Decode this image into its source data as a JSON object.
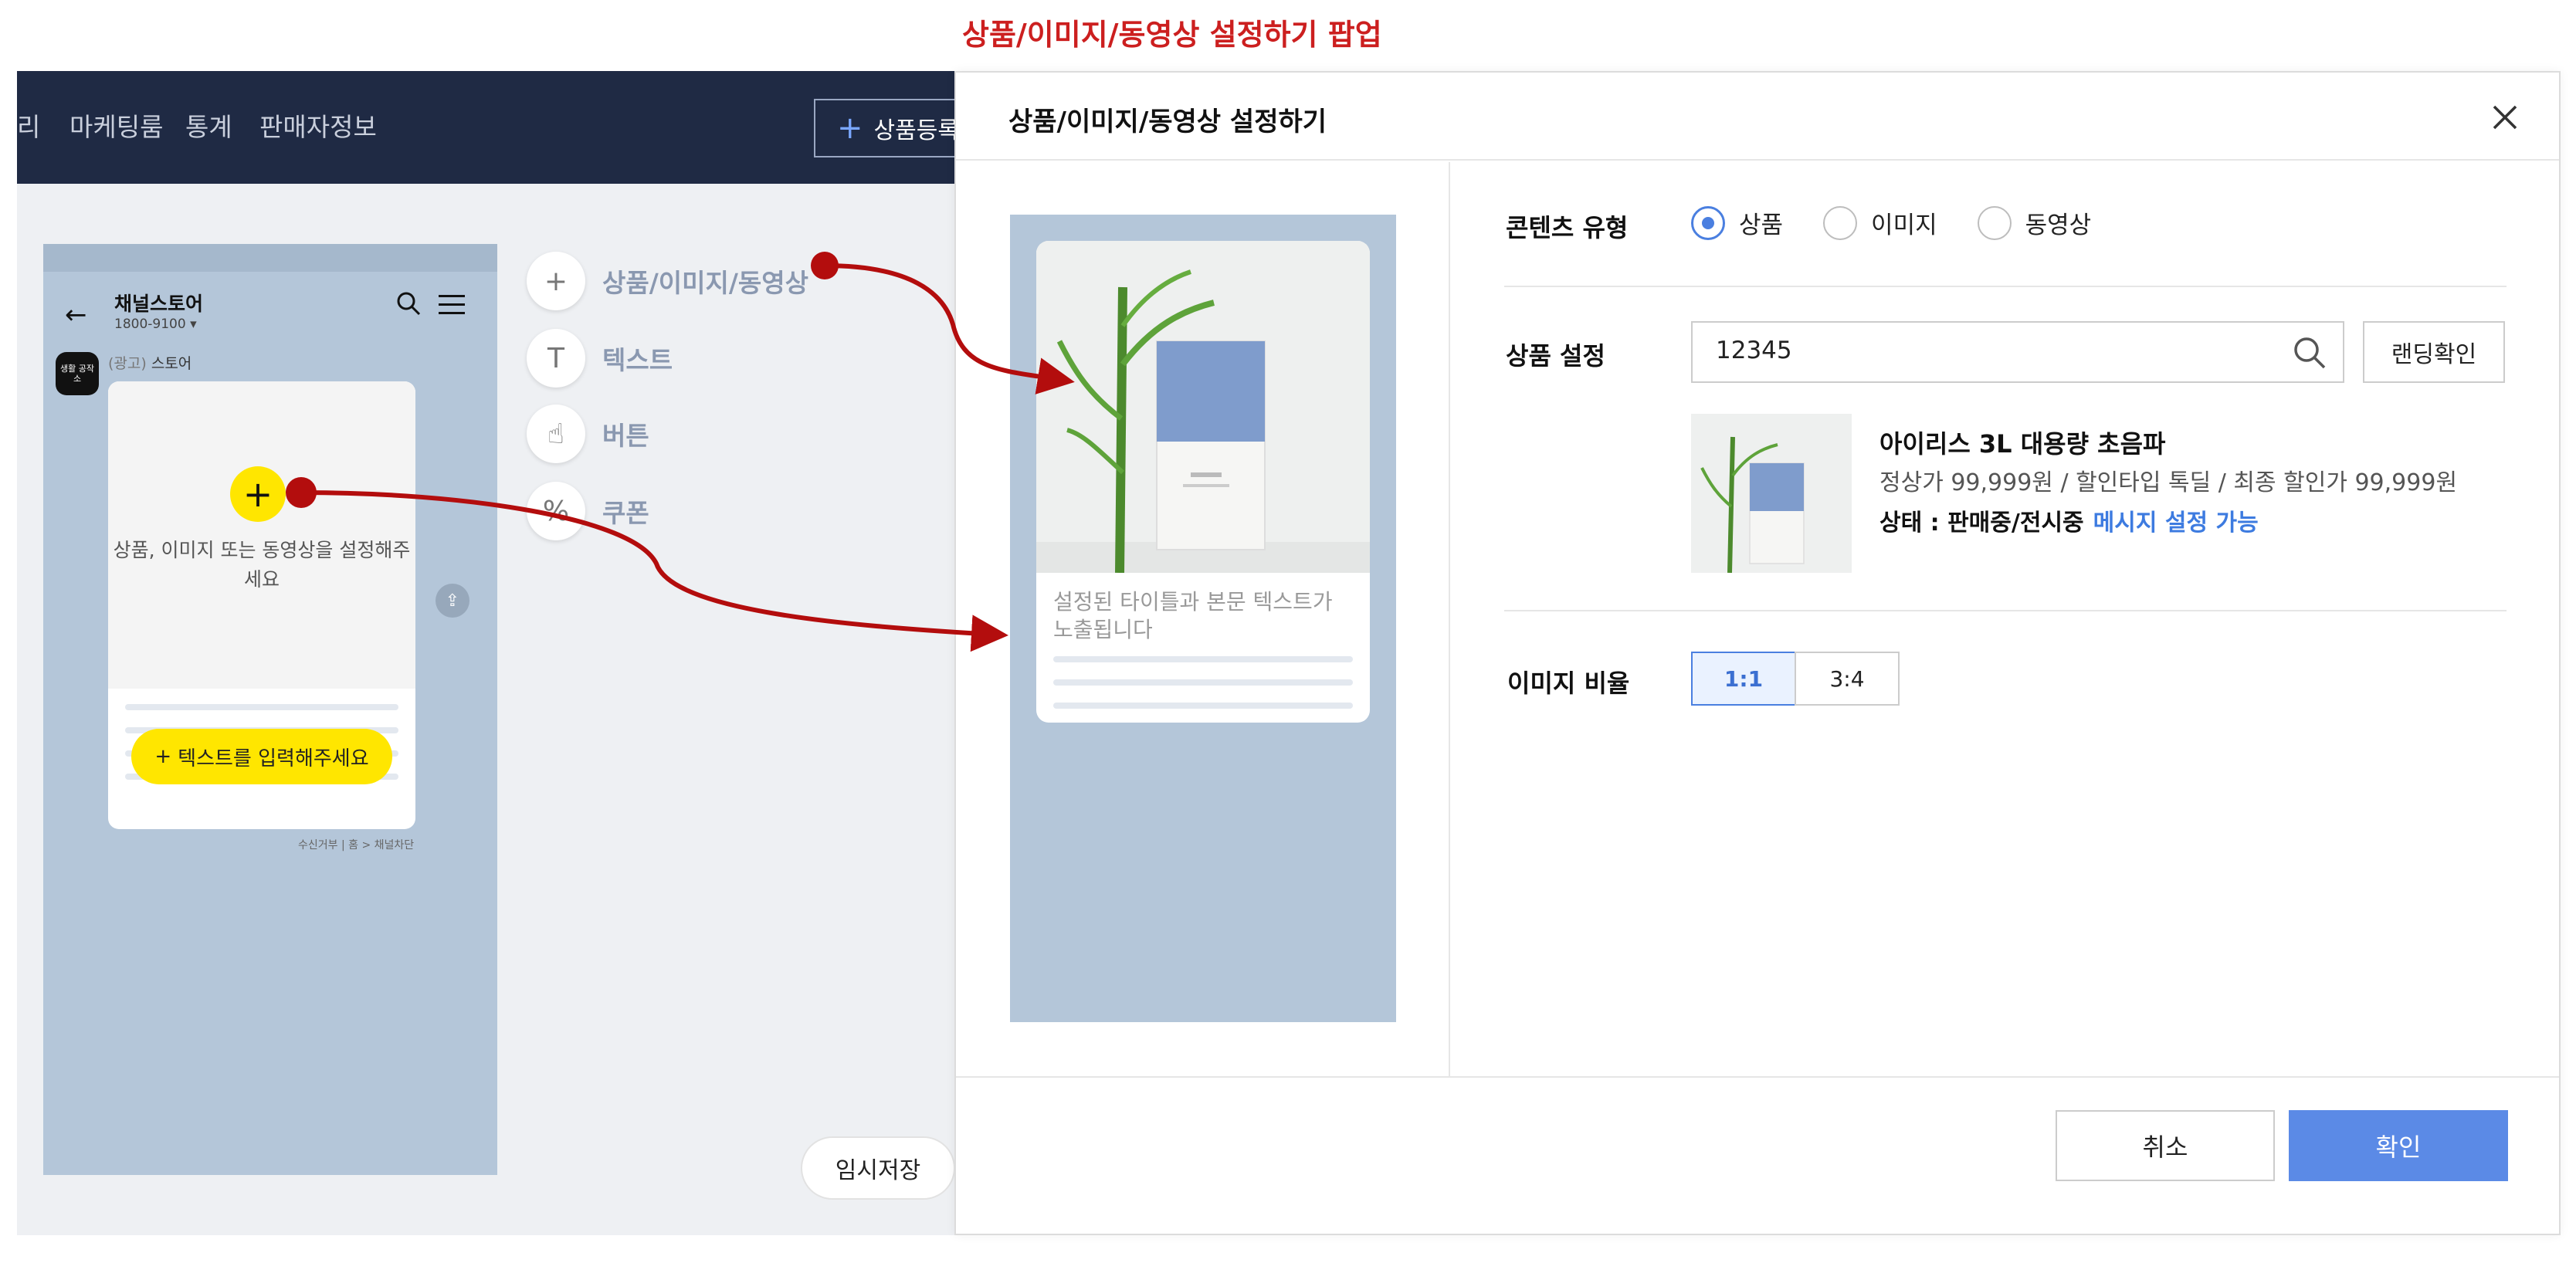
{
  "caption": "상품/이미지/동영상 설정하기 팝업",
  "app": {
    "nav": [
      "리",
      "마케팅룸",
      "통계",
      "판매자정보"
    ],
    "product_register": "상품등록",
    "phone": {
      "title": "채널스토어",
      "phone_number": "1800-9100",
      "avatar_text": "생활 공작 소",
      "ad_prefix": "(광고)",
      "ad_name": "스토어",
      "card_message": "상품, 이미지 또는 동영상을 설정해주세요",
      "text_button": "텍스트를 입력해주세요",
      "footer": "수신거부 | 홈 > 채널차단"
    },
    "tools": [
      {
        "icon": "plus-icon",
        "label": "상품/이미지/동영상"
      },
      {
        "icon": "text-icon",
        "label": "텍스트"
      },
      {
        "icon": "hand-pointer-icon",
        "label": "버튼"
      },
      {
        "icon": "percent-icon",
        "label": "쿠폰"
      }
    ],
    "temp_save": "임시저장"
  },
  "popup": {
    "title": "상품/이미지/동영상 설정하기",
    "preview": {
      "text": "설정된 타이틀과 본문 텍스트가 노출됩니다"
    },
    "content_type": {
      "label": "콘텐츠 유형",
      "options": [
        "상품",
        "이미지",
        "동영상"
      ],
      "selected": "상품"
    },
    "product": {
      "label": "상품 설정",
      "search_value": "12345",
      "landing_button": "랜딩확인",
      "name": "아이리스 3L 대용량 초음파",
      "price_line": "정상가 99,999원 / 할인타입 톡딜 / 최종 할인가 99,999원",
      "status": "상태 : 판매중/전시중",
      "status_link": "메시지 설정 가능"
    },
    "ratio": {
      "label": "이미지 비율",
      "options": [
        "1:1",
        "3:4"
      ],
      "selected": "1:1"
    },
    "cancel": "취소",
    "confirm": "확인"
  },
  "colors": {
    "caption": "#cc1f1f",
    "topbar": "#1f2a44",
    "accent": "#4a7fe0",
    "confirm": "#5b8ae6",
    "highlight_yellow": "#ffe600",
    "arrow": "#b30d0d"
  }
}
